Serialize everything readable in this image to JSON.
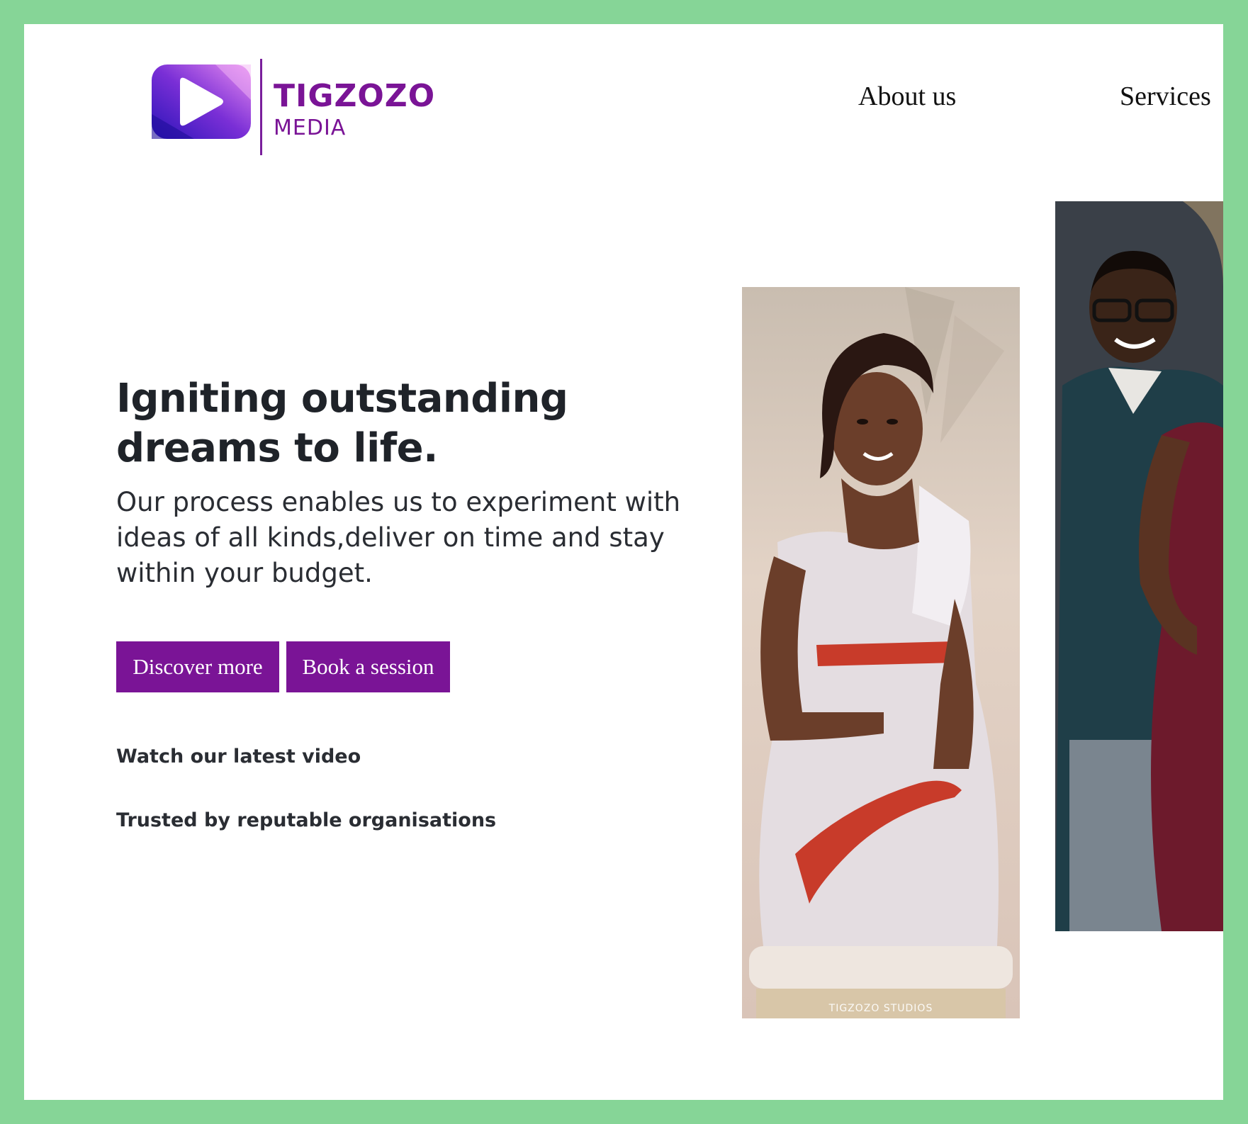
{
  "brand": {
    "name": "TIGZOZO",
    "sub": "MEDIA",
    "icon": "play-icon",
    "color": "#7a1496"
  },
  "nav": {
    "items": [
      {
        "label": "About us"
      },
      {
        "label": "Services"
      }
    ]
  },
  "hero": {
    "headline": "Igniting outstanding dreams to life.",
    "lead": "Our process enables us to experiment with ideas of all kinds,deliver on time and stay within your budget.",
    "buttons": {
      "discover": "Discover more",
      "book": "Book a session"
    },
    "watch_link": "Watch our latest video",
    "trusted": "Trusted by reputable organisations"
  },
  "gallery": {
    "watermark": "TIGZOZO STUDIOS"
  },
  "colors": {
    "accent": "#7a1496",
    "frame": "#86d597",
    "text": "#1f2329"
  }
}
